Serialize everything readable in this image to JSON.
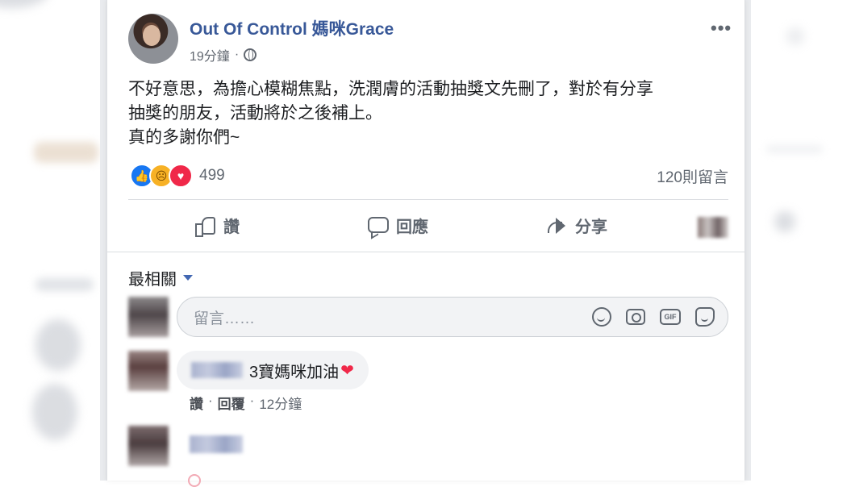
{
  "post": {
    "author": "Out Of Control 媽咪Grace",
    "time": "19分鐘",
    "separator": "·",
    "more": "•••",
    "text_lines": [
      "不好意思，為擔心模糊焦點，洗潤膚的活動抽獎文先刪了，對於有分享",
      "抽獎的朋友，活動將於之後補上。",
      "真的多謝你們~"
    ]
  },
  "reactions": {
    "icons": [
      "like-icon",
      "sad-icon",
      "love-icon"
    ],
    "count": "499",
    "comments": "120則留言"
  },
  "actions": {
    "like": "讚",
    "comment": "回應",
    "share": "分享"
  },
  "comments_section": {
    "sort_label": "最相關",
    "input_placeholder": "留言……",
    "comment1": {
      "text": "3寶媽咪加油",
      "like": "讚",
      "reply": "回覆",
      "time": "12分鐘",
      "separator": "·"
    }
  },
  "colors": {
    "author_blue": "#385898",
    "like_blue": "#1877f2",
    "love_red": "#f02849",
    "sad_yellow": "#f7b125"
  }
}
